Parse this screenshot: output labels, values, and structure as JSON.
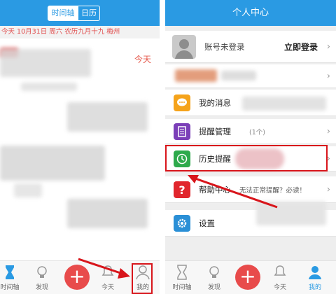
{
  "left_screen": {
    "tabs": [
      {
        "label": "时间轴"
      },
      {
        "label": "日历"
      }
    ],
    "date_bar": "今天 10月31日 周六 农历九月十九 梅州",
    "today_tag": "今天",
    "nav": [
      {
        "label": "时间轴",
        "icon": "hourglass-icon"
      },
      {
        "label": "发现",
        "icon": "lightbulb-icon"
      },
      {
        "label": "",
        "icon": "plus-icon"
      },
      {
        "label": "今天",
        "icon": "bell-icon"
      },
      {
        "label": "我的",
        "icon": "person-icon"
      }
    ]
  },
  "right_screen": {
    "header_title": "个人中心",
    "account": {
      "status": "账号未登录",
      "login_label": "立即登录"
    },
    "menu": [
      {
        "label": "我的消息",
        "icon": "message-icon",
        "icon_color": "#f5a31b"
      },
      {
        "label": "提醒管理",
        "extra": "(1个)",
        "icon": "list-icon",
        "icon_color": "#7b3fb8"
      },
      {
        "label": "历史提醒",
        "icon": "clock-icon",
        "icon_color": "#2eaa4c"
      },
      {
        "label": "帮助中心",
        "extra": "无法正常提醒？必读！",
        "icon": "question-icon",
        "icon_color": "#e1262d"
      },
      {
        "label": "设置",
        "icon": "gear-icon",
        "icon_color": "#2a8fd6"
      }
    ],
    "nav": [
      {
        "label": "时间轴",
        "icon": "hourglass-icon"
      },
      {
        "label": "发现",
        "icon": "lightbulb-icon"
      },
      {
        "label": "",
        "icon": "plus-icon"
      },
      {
        "label": "今天",
        "icon": "bell-icon"
      },
      {
        "label": "我的",
        "icon": "person-icon"
      }
    ]
  },
  "colors": {
    "header_blue": "#2a9ae3",
    "accent_red": "#e84b4b",
    "annotation_red": "#d8151b"
  }
}
